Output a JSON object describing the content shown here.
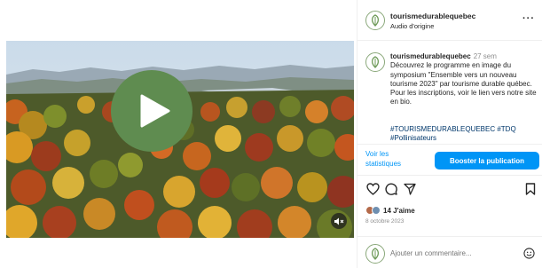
{
  "post": {
    "username": "tourismedurablequebec",
    "audio_label": "Audio d'origine",
    "more_label": "···"
  },
  "caption": {
    "username": "tourismedurablequebec",
    "time": "27 sem",
    "text": "Découvrez le programme en image du symposium \"Ensemble vers un nouveau tourisme 2023\" par tourisme durable québec. Pour les inscriptions, voir le lien vers notre site en bio.",
    "hashtags": "#TOURISMEDURABLEQUEBEC #TDQ #Pollinisateurs"
  },
  "insights": {
    "stats_link": "Voir les statistiques",
    "boost_button": "Booster la publication"
  },
  "engagement": {
    "likes": "14 J'aime",
    "date": "8 octobre 2023"
  },
  "comment": {
    "placeholder": "Ajouter un commentaire..."
  },
  "icons": {
    "play": "play-icon",
    "mute": "muted-speaker-icon",
    "like": "heart-outline-icon",
    "comment": "speech-bubble-icon",
    "share": "paper-plane-icon",
    "save": "bookmark-icon",
    "emoji": "smiley-icon"
  },
  "colors": {
    "accent_blue": "#0095f6",
    "play_green": "#5f8c50",
    "link_navy": "#00376b",
    "muted_gray": "#8e8e8e"
  }
}
